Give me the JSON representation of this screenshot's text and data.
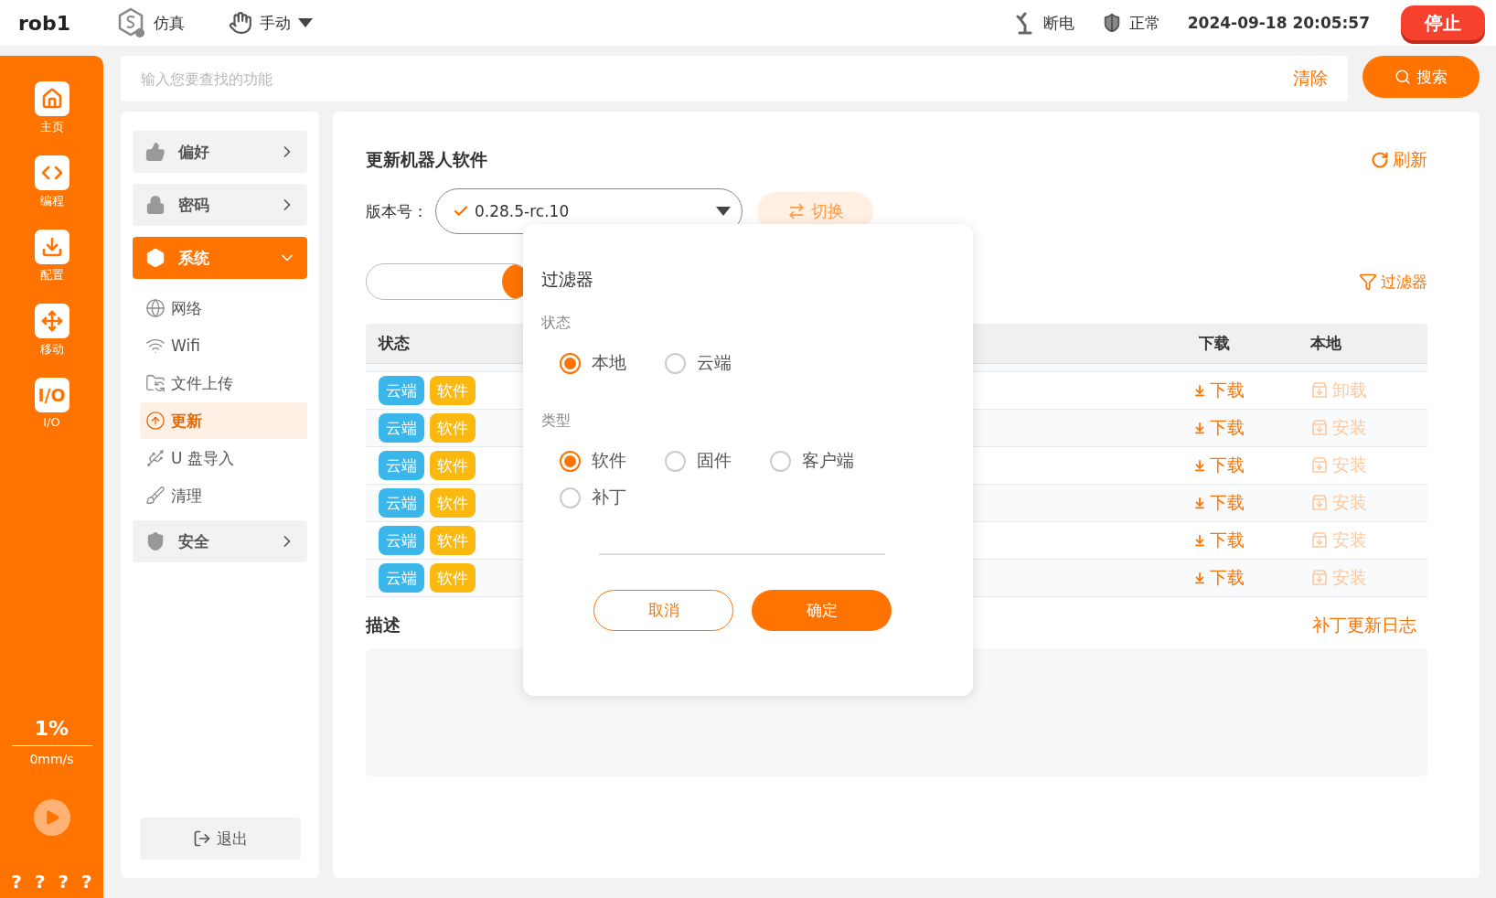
{
  "top_bar": {
    "robot": "rob1",
    "mode": "仿真",
    "control": "手动",
    "power": "断电",
    "status": "正常",
    "datetime": "2024-09-18 20:05:57",
    "stop": "停止"
  },
  "search": {
    "placeholder": "输入您要查找的功能",
    "clear": "清除",
    "button": "搜索"
  },
  "rail": {
    "items": [
      {
        "label": "主页"
      },
      {
        "label": "编程"
      },
      {
        "label": "配置"
      },
      {
        "label": "移动"
      },
      {
        "label": "I/O",
        "glyph": "I/O"
      }
    ],
    "speed": "1%",
    "velocity": "0mm/s",
    "help": [
      "?",
      "?",
      "?",
      "?"
    ]
  },
  "menu": {
    "groups": [
      {
        "label": "偏好",
        "expanded": false
      },
      {
        "label": "密码",
        "expanded": false
      },
      {
        "label": "系统",
        "expanded": true,
        "children": [
          {
            "label": "网络",
            "selected": false
          },
          {
            "label": "Wifi",
            "selected": false
          },
          {
            "label": "文件上传",
            "selected": false
          },
          {
            "label": "更新",
            "selected": true
          },
          {
            "label": "U 盘导入",
            "selected": false
          },
          {
            "label": "清理",
            "selected": false
          }
        ]
      },
      {
        "label": "安全",
        "expanded": false
      }
    ],
    "logout": "退出"
  },
  "main": {
    "title": "更新机器人软件",
    "refresh": "刷新",
    "version_label": "版本号：",
    "version": "0.28.5-rc.10",
    "switch": "切换",
    "filter": "过滤器",
    "table": {
      "columns": [
        "状态",
        "下载",
        "本地"
      ],
      "rows": [
        {
          "tags": [
            {
              "label": "云端",
              "color": "#3bb6ea"
            },
            {
              "label": "软件",
              "color": "#fbb910"
            }
          ],
          "download": "下载",
          "local": {
            "label": "卸载",
            "disabled": true
          }
        },
        {
          "tags": [
            {
              "label": "云端",
              "color": "#3bb6ea"
            },
            {
              "label": "软件",
              "color": "#fbb910"
            }
          ],
          "download": "下载",
          "local": {
            "label": "安装",
            "disabled": true
          }
        },
        {
          "tags": [
            {
              "label": "云端",
              "color": "#3bb6ea"
            },
            {
              "label": "软件",
              "color": "#fbb910"
            }
          ],
          "download": "下载",
          "local": {
            "label": "安装",
            "disabled": true
          }
        },
        {
          "tags": [
            {
              "label": "云端",
              "color": "#3bb6ea"
            },
            {
              "label": "软件",
              "color": "#fbb910"
            }
          ],
          "download": "下载",
          "local": {
            "label": "安装",
            "disabled": true
          }
        },
        {
          "tags": [
            {
              "label": "云端",
              "color": "#3bb6ea"
            },
            {
              "label": "软件",
              "color": "#fbb910"
            }
          ],
          "download": "下载",
          "local": {
            "label": "安装",
            "disabled": true
          }
        },
        {
          "tags": [
            {
              "label": "云端",
              "color": "#3bb6ea"
            },
            {
              "label": "软件",
              "color": "#fbb910"
            }
          ],
          "download": "下载",
          "local": {
            "label": "安装",
            "disabled": true
          }
        }
      ]
    },
    "description_label": "描述",
    "patch_log": "补丁更新日志"
  },
  "dialog": {
    "title": "过滤器",
    "sections": [
      {
        "label": "状态",
        "options": [
          {
            "label": "本地",
            "selected": true
          },
          {
            "label": "云端",
            "selected": false
          }
        ]
      },
      {
        "label": "类型",
        "options": [
          {
            "label": "软件",
            "selected": true
          },
          {
            "label": "固件",
            "selected": false
          },
          {
            "label": "客户端",
            "selected": false
          },
          {
            "label": "补丁",
            "selected": false
          }
        ]
      }
    ],
    "cancel": "取消",
    "confirm": "确定"
  }
}
